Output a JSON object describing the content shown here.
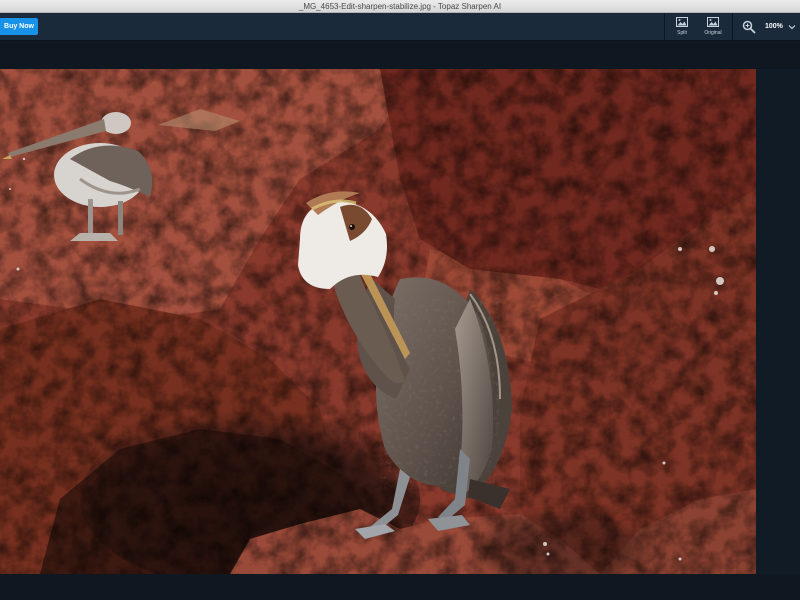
{
  "window": {
    "title": "_MG_4653-Edit-sharpen-stabilize.jpg - Topaz Sharpen AI"
  },
  "toolbar": {
    "buy_label": "Buy Now",
    "split_label": "Split",
    "split_icon": "split-view-icon",
    "original_label": "Original",
    "original_icon": "original-view-icon",
    "zoom_icon": "zoom-in-icon",
    "zoom_value": "100%",
    "zoom_chevron_icon": "chevron-down-icon"
  },
  "colors": {
    "accent": "#1792e8",
    "toolbar_bg": "#1a2a3b",
    "workspace_bg": "#0f1821"
  },
  "photo": {
    "subject": "pelicans-on-red-rocks"
  }
}
